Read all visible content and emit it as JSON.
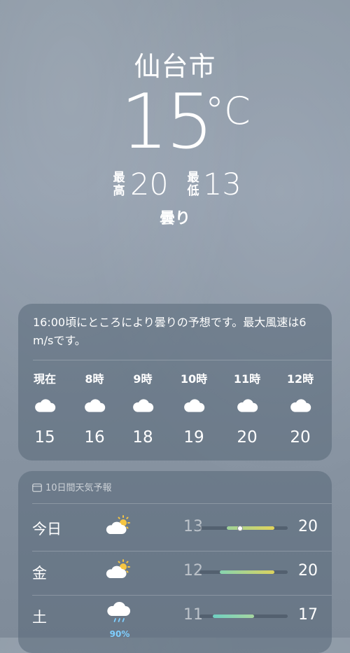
{
  "location": {
    "city": "仙台市"
  },
  "current": {
    "temperature": "15",
    "unit": "°C",
    "condition": "曇り"
  },
  "high_low": {
    "high_label_1": "最",
    "high_label_2": "高",
    "high": "20",
    "low_label_1": "最",
    "low_label_2": "低",
    "low": "13"
  },
  "hourly": {
    "summary": "16:00頃にところにより曇りの予想です。最大風速は6 m/sです。",
    "items": [
      {
        "time": "現在",
        "icon": "cloud-icon",
        "temp": "15"
      },
      {
        "time": "8時",
        "icon": "cloud-icon",
        "temp": "16"
      },
      {
        "time": "9時",
        "icon": "cloud-icon",
        "temp": "18"
      },
      {
        "time": "10時",
        "icon": "cloud-icon",
        "temp": "19"
      },
      {
        "time": "11時",
        "icon": "cloud-icon",
        "temp": "20"
      },
      {
        "time": "12時",
        "icon": "cloud-icon",
        "temp": "20"
      }
    ]
  },
  "daily": {
    "title": "10日間天気予報",
    "icon": "calendar-icon",
    "range_scale": {
      "min": 9,
      "max": 22
    },
    "days": [
      {
        "day": "今日",
        "icon": "partly-sunny-icon",
        "low": "13",
        "high": "20",
        "precip": "",
        "current_temp": 15,
        "gradient": [
          "#9ed39a",
          "#e2d45a"
        ]
      },
      {
        "day": "金",
        "icon": "partly-sunny-icon",
        "low": "12",
        "high": "20",
        "precip": "",
        "gradient": [
          "#86d4b0",
          "#dcd35e"
        ]
      },
      {
        "day": "土",
        "icon": "cloud-rain-icon",
        "low": "11",
        "high": "17",
        "precip": "90%",
        "gradient": [
          "#6fd0c2",
          "#a6d6a0"
        ]
      }
    ]
  },
  "colors": {
    "sun": "#f5c542",
    "precip": "#7fcfff"
  }
}
